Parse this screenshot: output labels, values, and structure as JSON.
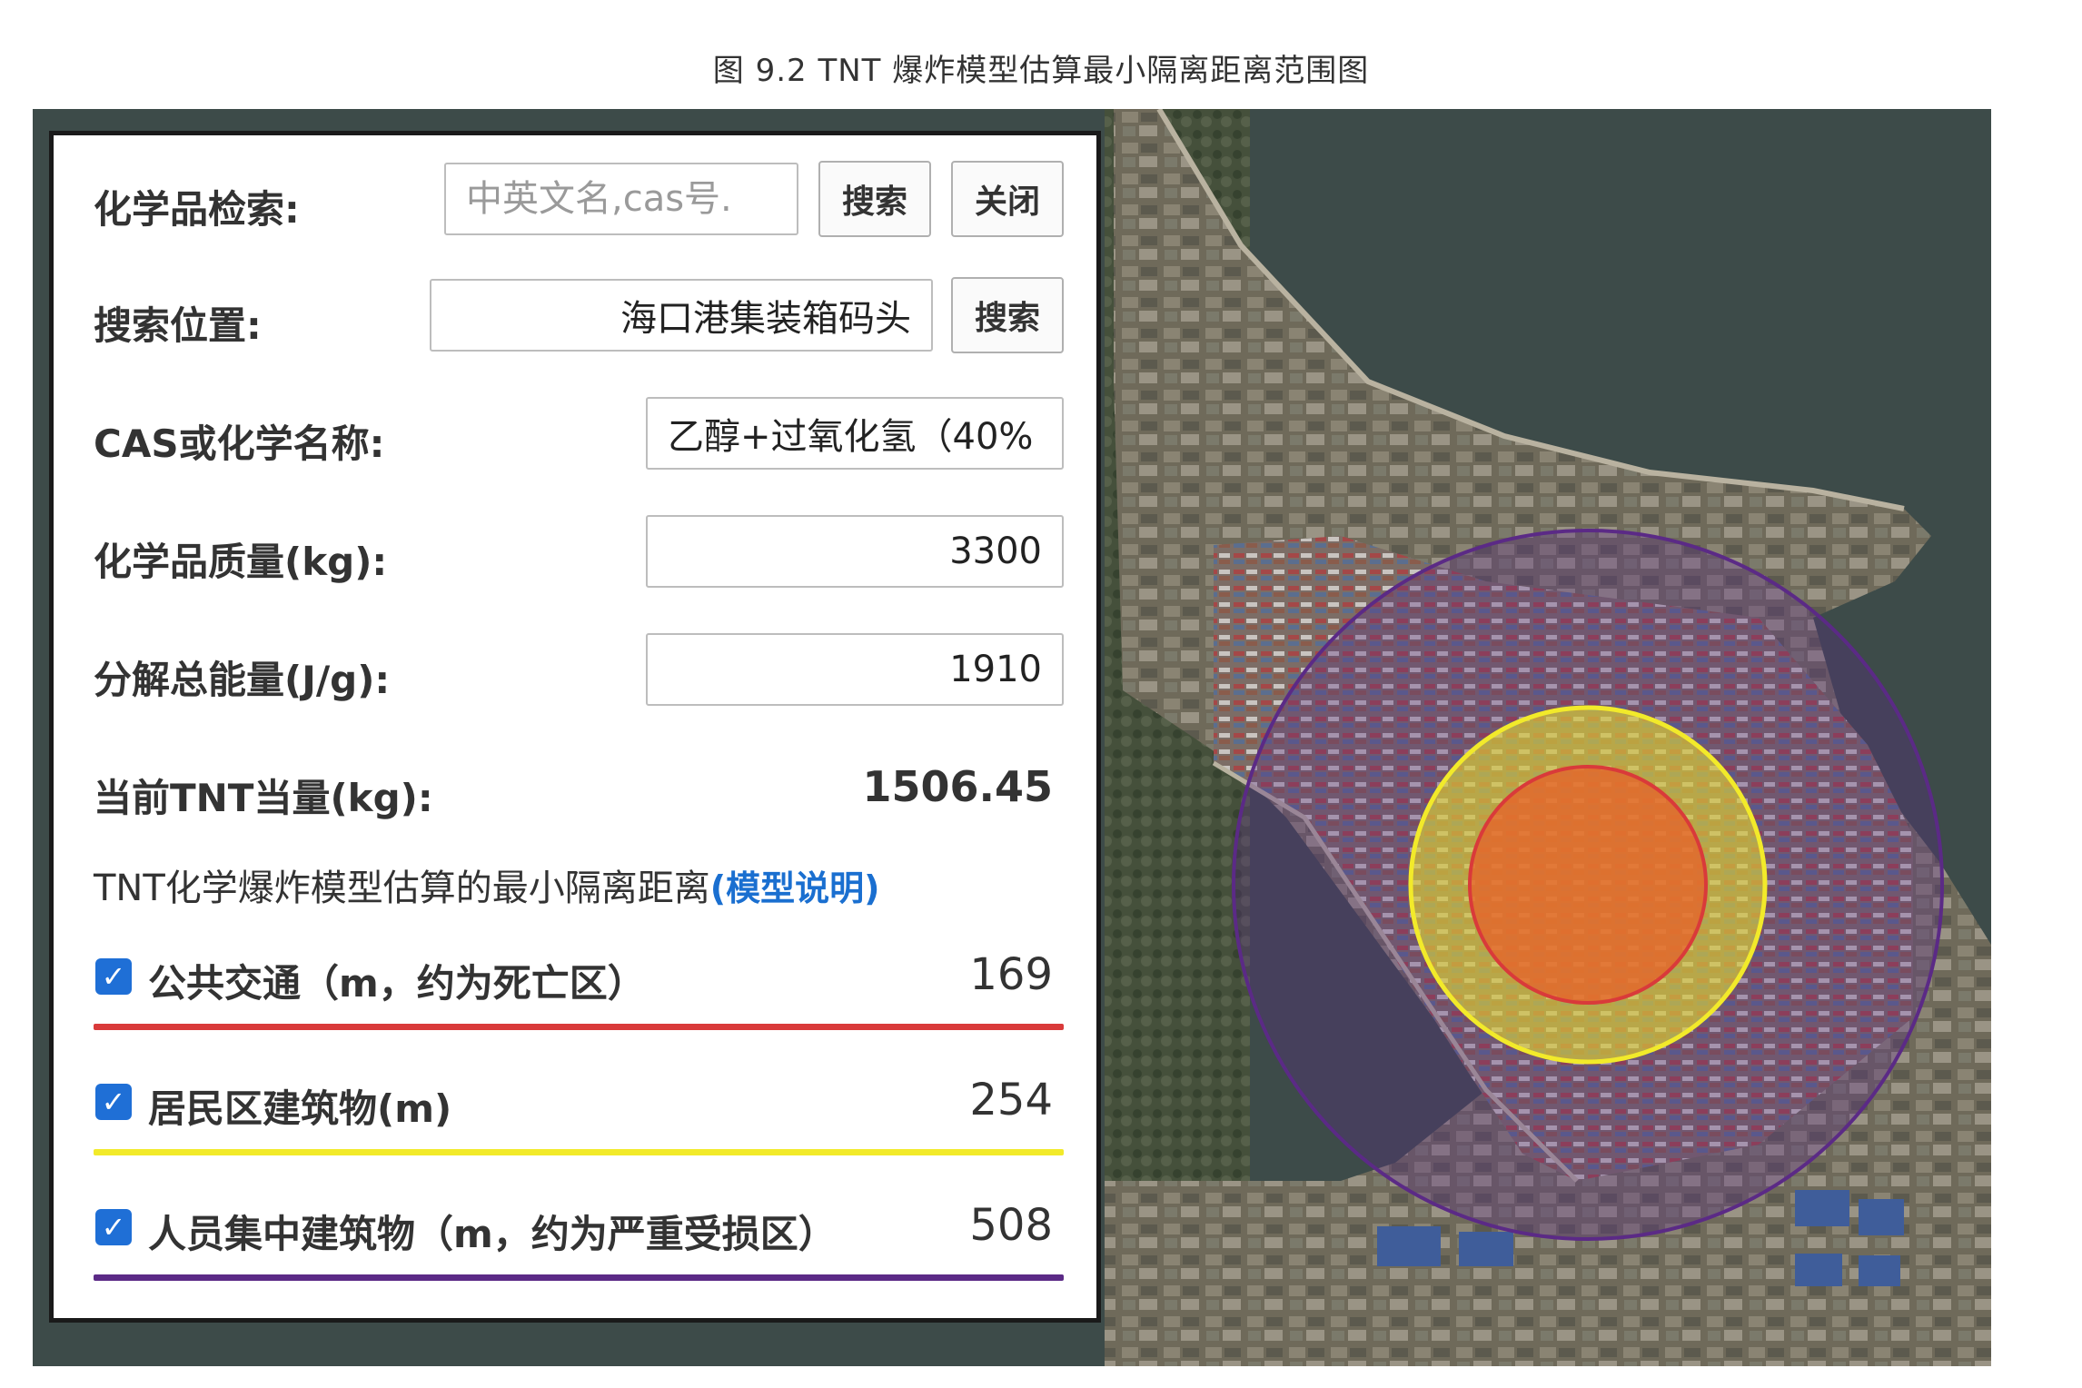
{
  "caption": "图 9.2 TNT 爆炸模型估算最小隔离距离范围图",
  "panel": {
    "search_chem": {
      "label": "化学品检索:",
      "placeholder": "中英文名,cas号.",
      "search_button": "搜索",
      "close_button": "关闭"
    },
    "search_location": {
      "label": "搜索位置:",
      "value": "海口港集装箱码头",
      "search_button": "搜索"
    },
    "cas_name": {
      "label": "CAS或化学名称:",
      "value": "乙醇+过氧化氢（40%"
    },
    "mass": {
      "label": "化学品质量(kg):",
      "value": "3300"
    },
    "energy": {
      "label": "分解总能量(J/g):",
      "value": "1910"
    },
    "tnt": {
      "label": "当前TNT当量(kg):",
      "value": "1506.45"
    },
    "model": {
      "title": "TNT化学爆炸模型估算的最小隔离距离",
      "link": "(模型说明)"
    },
    "zones": [
      {
        "label": "公共交通（m，约为死亡区）",
        "value": "169",
        "color": "#d93a3a"
      },
      {
        "label": "居民区建筑物(m)",
        "value": "254",
        "color": "#f2ea2a"
      },
      {
        "label": "人员集中建筑物（m，约为严重受损区）",
        "value": "508",
        "color": "#5b2a86"
      }
    ],
    "checkbox_mark": "✓"
  },
  "map_overlay": {
    "outer_color": "#5b2a86",
    "middle_color": "#f2ea2a",
    "inner_color": "#d93a3a"
  }
}
